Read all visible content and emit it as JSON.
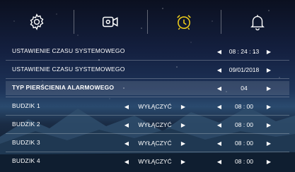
{
  "tabs": [
    {
      "name": "settings",
      "icon": "gear-icon"
    },
    {
      "name": "video",
      "icon": "video-camera-icon"
    },
    {
      "name": "alarm",
      "icon": "alarm-clock-icon",
      "active": true
    },
    {
      "name": "notification",
      "icon": "bell-icon"
    }
  ],
  "colors": {
    "active_tab": "#f5d21a",
    "icon": "#ffffff"
  },
  "rows": [
    {
      "label": "USTAWIENIE CZASU SYSTEMOWEGO",
      "value": "08 : 24 : 13"
    },
    {
      "label": "USTAWIENIE CZASU SYSTEMOWEGO",
      "value": "09/01/2018"
    },
    {
      "label": "TYP PIERŚCIENIA ALARMOWEGO",
      "value": "04"
    },
    {
      "label": "BUDZIK 1",
      "mode": "WYŁĄCZYĆ",
      "value": "08 : 00"
    },
    {
      "label": "BUDZIK 2",
      "mode": "WYŁĄCZYĆ",
      "value": "08 : 00"
    },
    {
      "label": "BUDZIK 3",
      "mode": "WYŁĄCZYĆ",
      "value": "08 : 00"
    },
    {
      "label": "BUDZIK 4",
      "mode": "WYŁĄCZYĆ",
      "value": "08 : 00"
    }
  ]
}
